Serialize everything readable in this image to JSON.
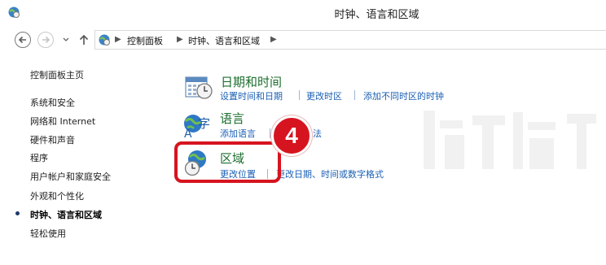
{
  "window": {
    "title": "时钟、语言和区域",
    "icon": "control-panel-icon"
  },
  "nav": {
    "back_icon": "back-arrow-icon",
    "forward_icon": "forward-arrow-icon",
    "up_icon": "up-arrow-icon",
    "breadcrumb": [
      "控制面板",
      "时钟、语言和区域"
    ]
  },
  "sidebar": {
    "items": [
      {
        "label": "控制面板主页"
      },
      {
        "label": "系统和安全"
      },
      {
        "label": "网络和 Internet"
      },
      {
        "label": "硬件和声音"
      },
      {
        "label": "程序"
      },
      {
        "label": "用户帐户和家庭安全"
      },
      {
        "label": "外观和个性化"
      },
      {
        "label": "时钟、语言和区域",
        "current": true
      },
      {
        "label": "轻松使用"
      }
    ]
  },
  "categories": [
    {
      "title": "日期和时间",
      "icon": "calendar-clock-icon",
      "links": [
        "设置时间和日期",
        "更改时区",
        "添加不同时区的时钟"
      ]
    },
    {
      "title": "语言",
      "icon": "language-icon",
      "links": [
        "添加语言",
        "更改输入法"
      ]
    },
    {
      "title": "区域",
      "icon": "globe-clock-icon",
      "links": [
        "更改位置",
        "更改日期、时间或数字格式"
      ]
    }
  ],
  "annotation": {
    "step_number": "4",
    "color": "#d6141f"
  },
  "colors": {
    "category_title": "#1c6e2e",
    "link": "#1a5fb4",
    "accent_red": "#d6141f"
  }
}
